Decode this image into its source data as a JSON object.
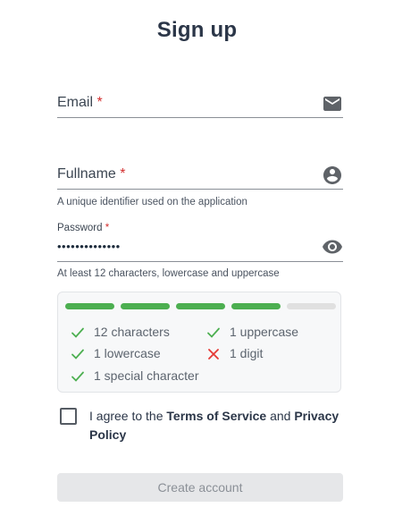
{
  "title": "Sign up",
  "email": {
    "label": "Email",
    "required_mark": "*",
    "icon": "mail-icon"
  },
  "fullname": {
    "label": "Fullname",
    "required_mark": "*",
    "icon": "account-circle-icon",
    "helper": "A unique identifier used on the application"
  },
  "password": {
    "label": "Password",
    "required_mark": "*",
    "value": "••••••••••••••",
    "icon": "eye-icon",
    "helper": "At least 12 characters, lowercase and uppercase"
  },
  "strength": {
    "filled_segments": 4,
    "total_segments": 5,
    "filled_color": "#4caf50",
    "empty_color": "#e0e0e0",
    "requirements": [
      {
        "text": "12 characters",
        "met": true
      },
      {
        "text": "1 uppercase",
        "met": true
      },
      {
        "text": "1 lowercase",
        "met": true
      },
      {
        "text": "1 digit",
        "met": false
      },
      {
        "text": "1 special character",
        "met": true
      }
    ],
    "met_color": "#4caf50",
    "unmet_color": "#e53935"
  },
  "terms": {
    "prefix": "I agree to the ",
    "tos": "Terms of Service",
    "and": " and ",
    "privacy": "Privacy Policy",
    "checked": false
  },
  "submit": {
    "label": "Create account",
    "disabled": true
  }
}
